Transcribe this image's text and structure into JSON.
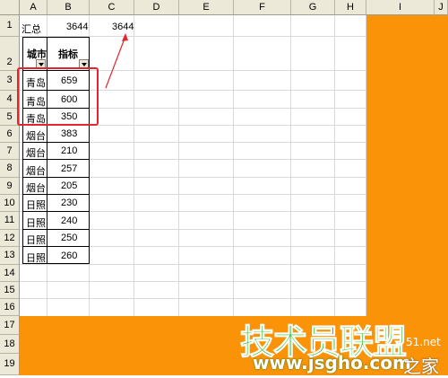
{
  "columns": [
    "A",
    "B",
    "C",
    "D",
    "E",
    "F",
    "G",
    "H",
    "I",
    "J"
  ],
  "rows": [
    "1",
    "2",
    "3",
    "4",
    "5",
    "6",
    "7",
    "8",
    "9",
    "10",
    "11",
    "12",
    "13",
    "14",
    "15",
    "16",
    "17",
    "18",
    "19"
  ],
  "summary": {
    "label": "汇总",
    "value_b": "3644",
    "value_c": "3644"
  },
  "headers": {
    "city": "城市",
    "metric": "指标"
  },
  "table_rows": [
    {
      "city": "青岛",
      "value": "659"
    },
    {
      "city": "青岛",
      "value": "600"
    },
    {
      "city": "青岛",
      "value": "350"
    },
    {
      "city": "烟台",
      "value": "383"
    },
    {
      "city": "烟台",
      "value": "210"
    },
    {
      "city": "烟台",
      "value": "257"
    },
    {
      "city": "烟台",
      "value": "205"
    },
    {
      "city": "日照",
      "value": "230"
    },
    {
      "city": "日照",
      "value": "240"
    },
    {
      "city": "日照",
      "value": "250"
    },
    {
      "city": "日照",
      "value": "260"
    }
  ],
  "watermark": {
    "brand": "技术员联盟",
    "url": "www.jsgho.com",
    "suffix": "之家",
    "small": "51.net"
  },
  "colors": {
    "accent_orange": "#fb9308",
    "highlight_red": "#e0262f",
    "watermark_green": "#1fb81f"
  }
}
